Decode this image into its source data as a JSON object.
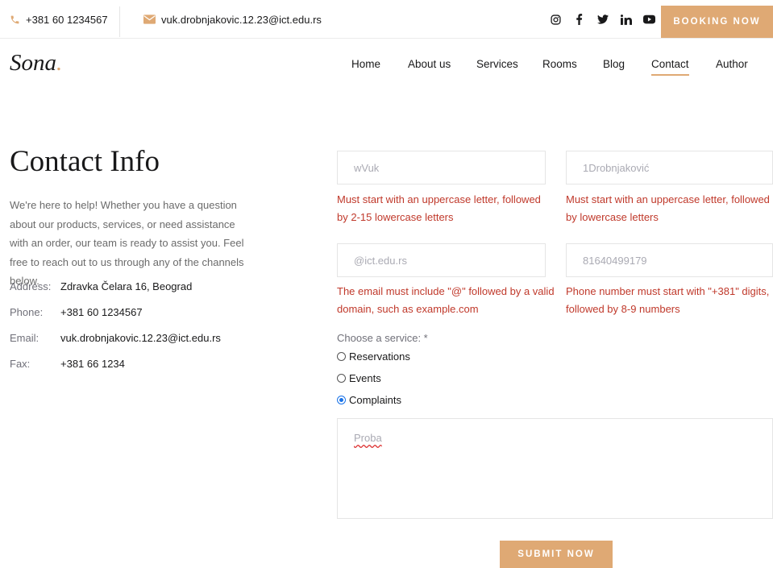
{
  "topbar": {
    "phone": "+381 60 1234567",
    "email": "vuk.drobnjakovic.12.23@ict.edu.rs",
    "social_icons": [
      "instagram-icon",
      "facebook-icon",
      "twitter-icon",
      "linkedin-icon",
      "youtube-icon"
    ],
    "booking_label": "BOOKING NOW"
  },
  "header": {
    "logo_text": "Sona",
    "logo_dot": ".",
    "nav": [
      "Home",
      "About us",
      "Services",
      "Rooms",
      "Blog",
      "Contact",
      "Author"
    ],
    "active_nav": "Contact"
  },
  "contact_info": {
    "title": "Contact Info",
    "description": "We're here to help! Whether you have a question about our products, services, or need assistance with an order, our team is ready to assist you. Feel free to reach out to us through any of the channels below.",
    "rows": [
      {
        "label": "Address:",
        "value": "Zdravka Čelara 16, Beograd"
      },
      {
        "label": "Phone:",
        "value": "+381 60 1234567"
      },
      {
        "label": "Email:",
        "value": "vuk.drobnjakovic.12.23@ict.edu.rs"
      },
      {
        "label": "Fax:",
        "value": "+381 66 1234"
      }
    ]
  },
  "form": {
    "first_name": {
      "value": "wVuk",
      "error": "Must start with an uppercase letter, followed by 2-15 lowercase letters"
    },
    "last_name": {
      "value": "1Drobnjaković",
      "error": "Must start with an uppercase letter, followed by lowercase letters"
    },
    "email": {
      "value": "@ict.edu.rs",
      "error": "The email must include \"@\" followed by a valid domain, such as example.com"
    },
    "phone": {
      "value": "81640499179",
      "error": "Phone number must start with \"+381\" digits, followed by 8-9 numbers"
    },
    "service_label": "Choose a service: *",
    "services": [
      "Reservations",
      "Events",
      "Complaints"
    ],
    "selected_service": "Complaints",
    "message": "Proba",
    "submit_label": "SUBMIT NOW"
  },
  "colors": {
    "accent": "#dfa974",
    "error": "#c0392b",
    "radio": "#1a73e8"
  }
}
